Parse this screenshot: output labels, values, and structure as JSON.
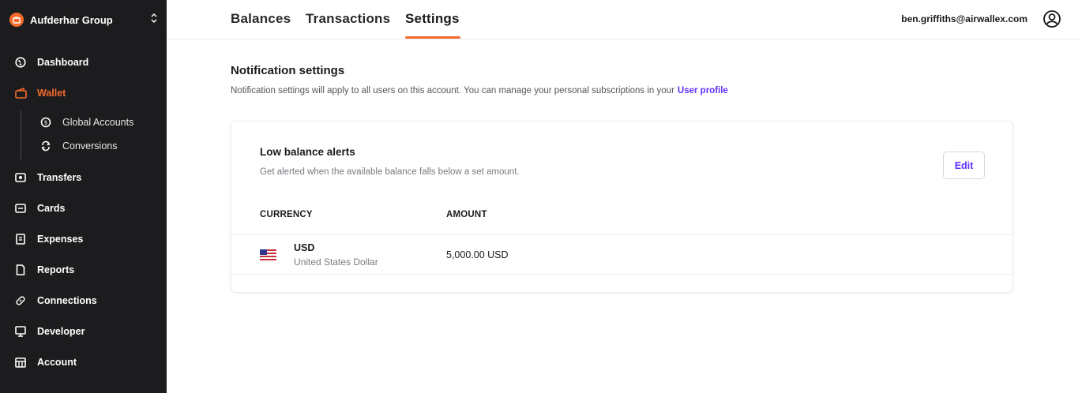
{
  "org": {
    "name": "Aufderhar Group",
    "logo_icon": "org-logo-icon",
    "switch_icon": "chevron-updown-icon"
  },
  "nav": {
    "items": [
      {
        "label": "Dashboard",
        "icon": "dashboard-icon"
      },
      {
        "label": "Wallet",
        "icon": "wallet-icon",
        "active": true
      },
      {
        "label": "Transfers",
        "icon": "transfers-icon"
      },
      {
        "label": "Cards",
        "icon": "cards-icon"
      },
      {
        "label": "Expenses",
        "icon": "expenses-icon"
      },
      {
        "label": "Reports",
        "icon": "reports-icon"
      },
      {
        "label": "Connections",
        "icon": "connections-icon"
      },
      {
        "label": "Developer",
        "icon": "developer-icon"
      },
      {
        "label": "Account",
        "icon": "account-icon"
      }
    ],
    "wallet_sub": [
      {
        "label": "Global Accounts",
        "icon": "global-accounts-icon"
      },
      {
        "label": "Conversions",
        "icon": "conversions-icon"
      }
    ]
  },
  "tabs": [
    {
      "label": "Balances"
    },
    {
      "label": "Transactions"
    },
    {
      "label": "Settings",
      "active": true
    }
  ],
  "user": {
    "email": "ben.griffiths@airwallex.com",
    "icon": "user-profile-icon"
  },
  "main": {
    "title": "Notification settings",
    "description": "Notification settings will apply to all users on this account. You can manage your personal subscriptions in your",
    "link_label": "User profile"
  },
  "card": {
    "title": "Low balance alerts",
    "description": "Get alerted when the available balance falls below a set amount.",
    "edit_label": "Edit",
    "columns": [
      "CURRENCY",
      "AMOUNT"
    ],
    "rows": [
      {
        "code": "USD",
        "name": "United States Dollar",
        "amount": "5,000.00 USD",
        "flag_icon": "us-flag-icon"
      }
    ]
  },
  "colors": {
    "accent": "#f36b2b",
    "link": "#612fff",
    "sidebar_bg": "#1c1c1e"
  }
}
